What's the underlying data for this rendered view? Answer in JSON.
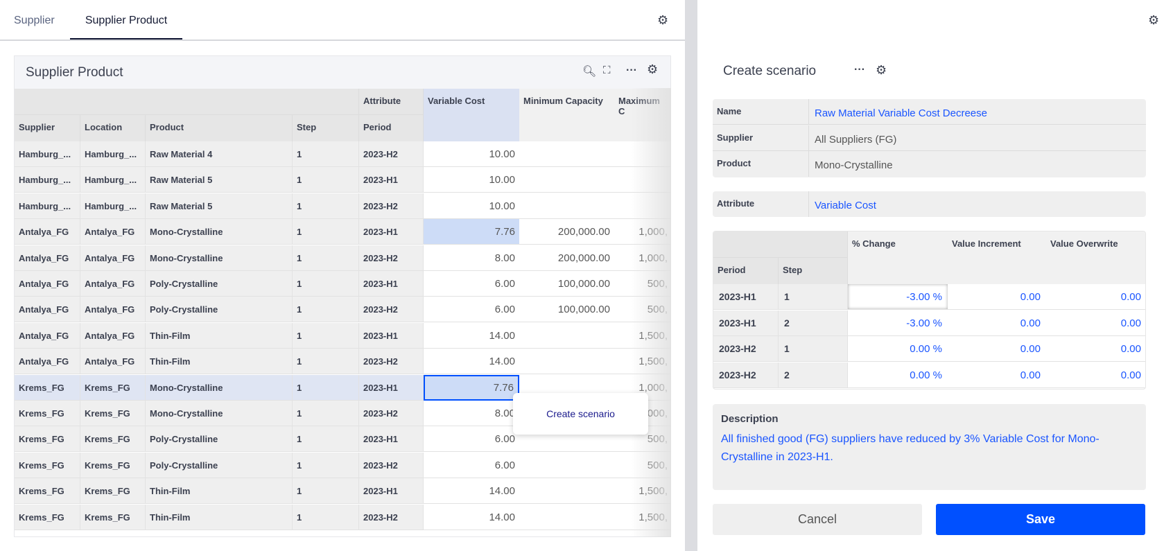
{
  "tabs": [
    {
      "label": "Supplier",
      "active": false
    },
    {
      "label": "Supplier Product",
      "active": true
    }
  ],
  "grid": {
    "title": "Supplier Product",
    "toolbar_icons": [
      "search-icon",
      "expand-icon",
      "more-icon",
      "gear-icon"
    ],
    "header_group": "Attribute",
    "columns": [
      "Supplier",
      "Location",
      "Product",
      "Step",
      "Period",
      "Variable Cost",
      "Minimum Capacity",
      "Maximum C"
    ],
    "rows": [
      [
        "Hamburg_...",
        "Hamburg_...",
        "Raw Material 4",
        "1",
        "2023-H2",
        "10.00",
        "",
        ""
      ],
      [
        "Hamburg_...",
        "Hamburg_...",
        "Raw Material 5",
        "1",
        "2023-H1",
        "10.00",
        "",
        ""
      ],
      [
        "Hamburg_...",
        "Hamburg_...",
        "Raw Material 5",
        "1",
        "2023-H2",
        "10.00",
        "",
        ""
      ],
      [
        "Antalya_FG",
        "Antalya_FG",
        "Mono-Crystalline",
        "1",
        "2023-H1",
        "7.76",
        "200,000.00",
        "1,000,"
      ],
      [
        "Antalya_FG",
        "Antalya_FG",
        "Mono-Crystalline",
        "1",
        "2023-H2",
        "8.00",
        "200,000.00",
        "1,000,"
      ],
      [
        "Antalya_FG",
        "Antalya_FG",
        "Poly-Crystalline",
        "1",
        "2023-H1",
        "6.00",
        "100,000.00",
        "500,"
      ],
      [
        "Antalya_FG",
        "Antalya_FG",
        "Poly-Crystalline",
        "1",
        "2023-H2",
        "6.00",
        "100,000.00",
        "500,"
      ],
      [
        "Antalya_FG",
        "Antalya_FG",
        "Thin-Film",
        "1",
        "2023-H1",
        "14.00",
        "",
        "1,500,"
      ],
      [
        "Antalya_FG",
        "Antalya_FG",
        "Thin-Film",
        "1",
        "2023-H2",
        "14.00",
        "",
        "1,500,"
      ],
      [
        "Krems_FG",
        "Krems_FG",
        "Mono-Crystalline",
        "1",
        "2023-H1",
        "7.76",
        "",
        "1,000,"
      ],
      [
        "Krems_FG",
        "Krems_FG",
        "Mono-Crystalline",
        "1",
        "2023-H2",
        "8.00",
        "",
        "1,000,"
      ],
      [
        "Krems_FG",
        "Krems_FG",
        "Poly-Crystalline",
        "1",
        "2023-H1",
        "6.00",
        "",
        "500,"
      ],
      [
        "Krems_FG",
        "Krems_FG",
        "Poly-Crystalline",
        "1",
        "2023-H2",
        "6.00",
        "",
        "500,"
      ],
      [
        "Krems_FG",
        "Krems_FG",
        "Thin-Film",
        "1",
        "2023-H1",
        "14.00",
        "",
        "1,500,"
      ],
      [
        "Krems_FG",
        "Krems_FG",
        "Thin-Film",
        "1",
        "2023-H2",
        "14.00",
        "",
        "1,500,"
      ]
    ],
    "selected_row": 9,
    "highlighted_cells": [
      3,
      9
    ],
    "context_menu": {
      "items": [
        "Create scenario"
      ]
    }
  },
  "scenario": {
    "title": "Create scenario",
    "fields": [
      {
        "label": "Name",
        "value": "Raw Material Variable Cost Decreese",
        "link": true
      },
      {
        "label": "Supplier",
        "value": "All Suppliers (FG)",
        "link": false
      },
      {
        "label": "Product",
        "value": "Mono-Crystalline",
        "link": false
      }
    ],
    "attribute": {
      "label": "Attribute",
      "value": "Variable Cost"
    },
    "table": {
      "columns": [
        "Period",
        "Step",
        "% Change",
        "Value Increment",
        "Value Overwrite"
      ],
      "rows": [
        [
          "2023-H1",
          "1",
          "-3.00 %",
          "0.00",
          "0.00"
        ],
        [
          "2023-H1",
          "2",
          "-3.00 %",
          "0.00",
          "0.00"
        ],
        [
          "2023-H2",
          "1",
          "0.00 %",
          "0.00",
          "0.00"
        ],
        [
          "2023-H2",
          "2",
          "0.00 %",
          "0.00",
          "0.00"
        ]
      ]
    },
    "description": {
      "label": "Description",
      "text": "All finished good (FG) suppliers have reduced by 3% Variable Cost for Mono-Crystalline in 2023-H1."
    },
    "cancel_label": "Cancel",
    "save_label": "Save"
  },
  "colors": {
    "accent": "#0050ff",
    "link": "#1a55ff",
    "selection": "#cddcf7",
    "menu_text": "#1a1a8c"
  }
}
